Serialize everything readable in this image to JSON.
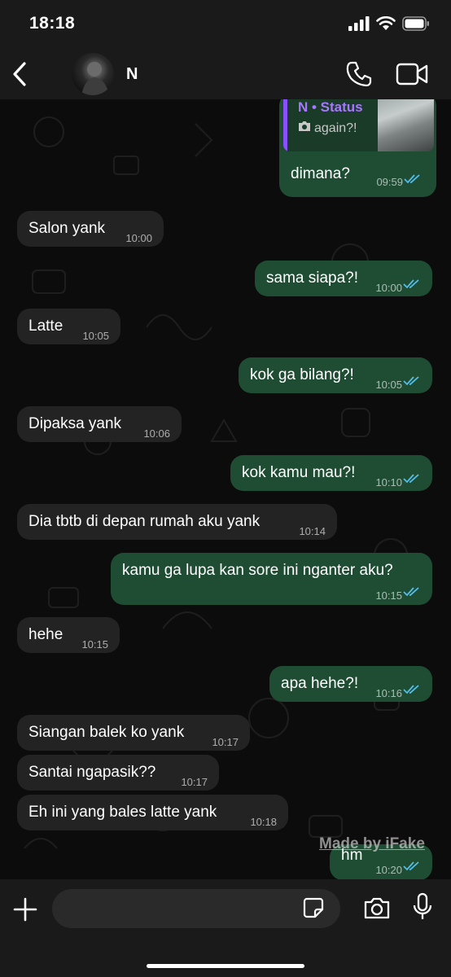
{
  "status_bar": {
    "time": "18:18"
  },
  "header": {
    "contact_name": "N"
  },
  "quote": {
    "title": "N • Status",
    "subtitle": "again?!"
  },
  "messages": [
    {
      "text": "dimana?",
      "time": "09:59"
    },
    {
      "text": "Salon yank",
      "time": "10:00"
    },
    {
      "text": "sama siapa?!",
      "time": "10:00"
    },
    {
      "text": "Latte",
      "time": "10:05"
    },
    {
      "text": "kok ga bilang?!",
      "time": "10:05"
    },
    {
      "text": "Dipaksa yank",
      "time": "10:06"
    },
    {
      "text": "kok kamu mau?!",
      "time": "10:10"
    },
    {
      "text": "Dia tbtb di depan rumah aku yank",
      "time": "10:14"
    },
    {
      "text": "kamu ga lupa kan sore ini nganter aku?",
      "time": "10:15"
    },
    {
      "text": "hehe",
      "time": "10:15"
    },
    {
      "text": "apa hehe?!",
      "time": "10:16"
    },
    {
      "text": "Siangan balek ko yank",
      "time": "10:17"
    },
    {
      "text": "Santai ngapasik??",
      "time": "10:17"
    },
    {
      "text": "Eh ini yang bales latte yank",
      "time": "10:18"
    },
    {
      "text": "hm",
      "time": "10:20"
    }
  ],
  "watermark": "Made by iFake",
  "colors": {
    "incoming": "#232323",
    "outgoing": "#1f4d33",
    "read_ticks": "#53bdeb",
    "status_accent": "#a877ff"
  },
  "icons": [
    "back-icon",
    "phone-icon",
    "video-icon",
    "camera-icon",
    "plus-icon",
    "sticker-icon",
    "mic-icon",
    "signal-icon",
    "wifi-icon",
    "battery-icon"
  ]
}
